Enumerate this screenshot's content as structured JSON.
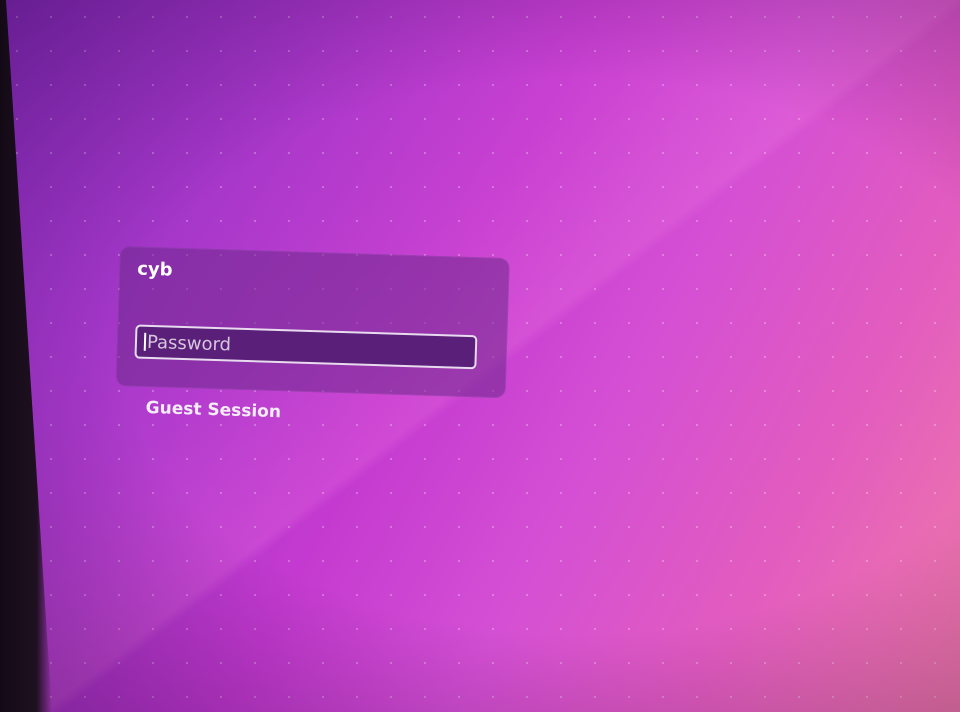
{
  "login": {
    "username": "cyb",
    "password_placeholder": "Password",
    "password_value": "",
    "guest_session_label": "Guest Session"
  },
  "colors": {
    "wallpaper_start": "#8a2fc3",
    "wallpaper_end": "#f07aa8",
    "card_background": "#6e288c",
    "input_background": "#5a1f78",
    "input_border": "#e8dbef",
    "text": "#ffffff"
  }
}
